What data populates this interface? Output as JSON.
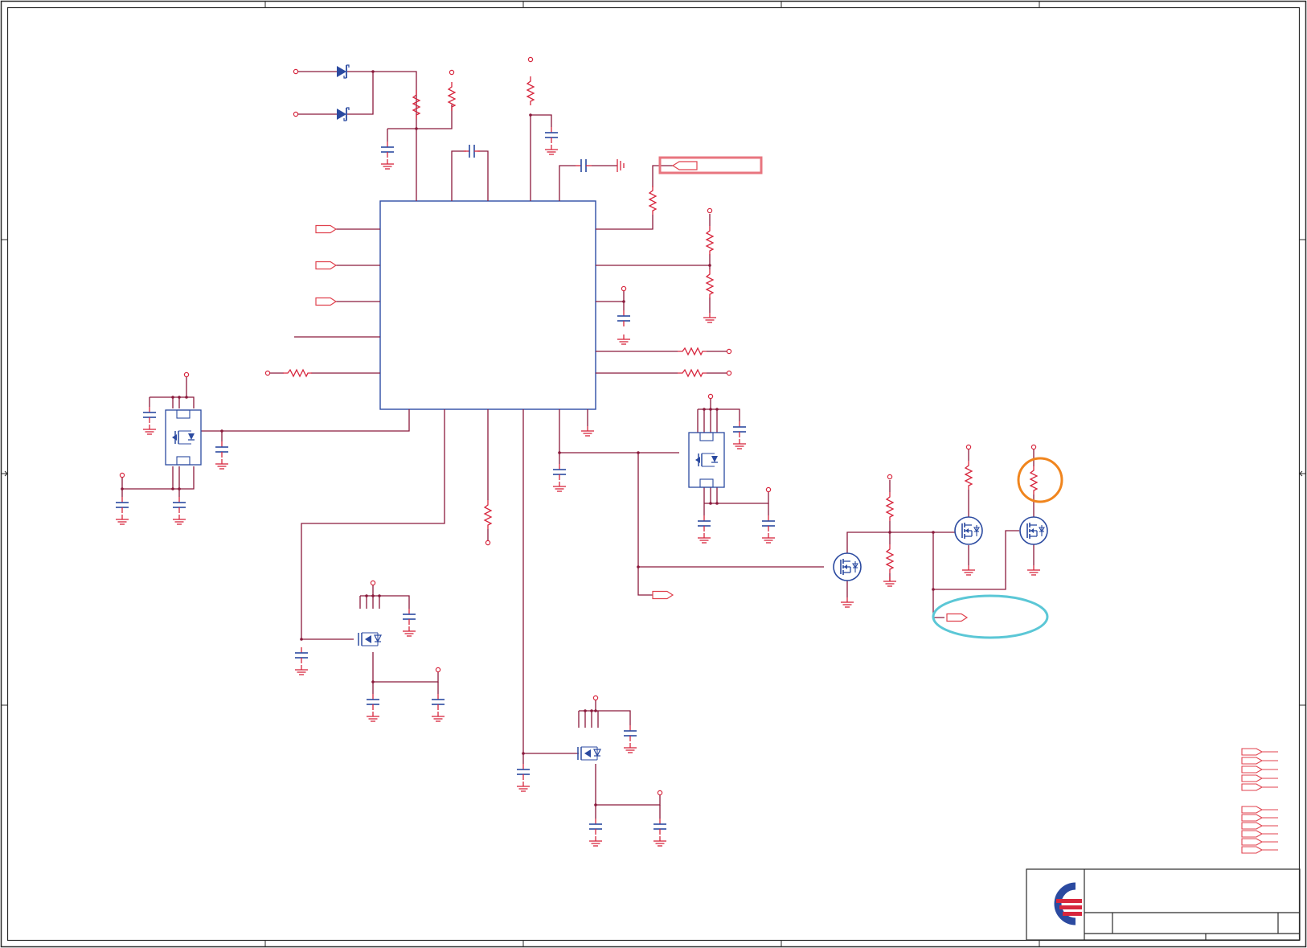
{
  "document": {
    "type": "schematic-sheet",
    "title_block_text": ""
  },
  "colors": {
    "wire": "#8b1a3c",
    "ic_body": "#2e4da6",
    "component": "#d7263d",
    "port": "#e0424e",
    "component_blue": "#2b4aa0",
    "highlight_box": "#e8757f",
    "highlight_orange": "#f0851e",
    "highlight_cyan": "#5bc7d6",
    "logo_blue": "#2b4aa0",
    "logo_red": "#d7263d"
  },
  "icons": [
    "logo-icon"
  ],
  "annotations": {
    "boxed_net_port": "highlighted",
    "circled_resistor": "highlighted",
    "circled_port": "highlighted"
  }
}
